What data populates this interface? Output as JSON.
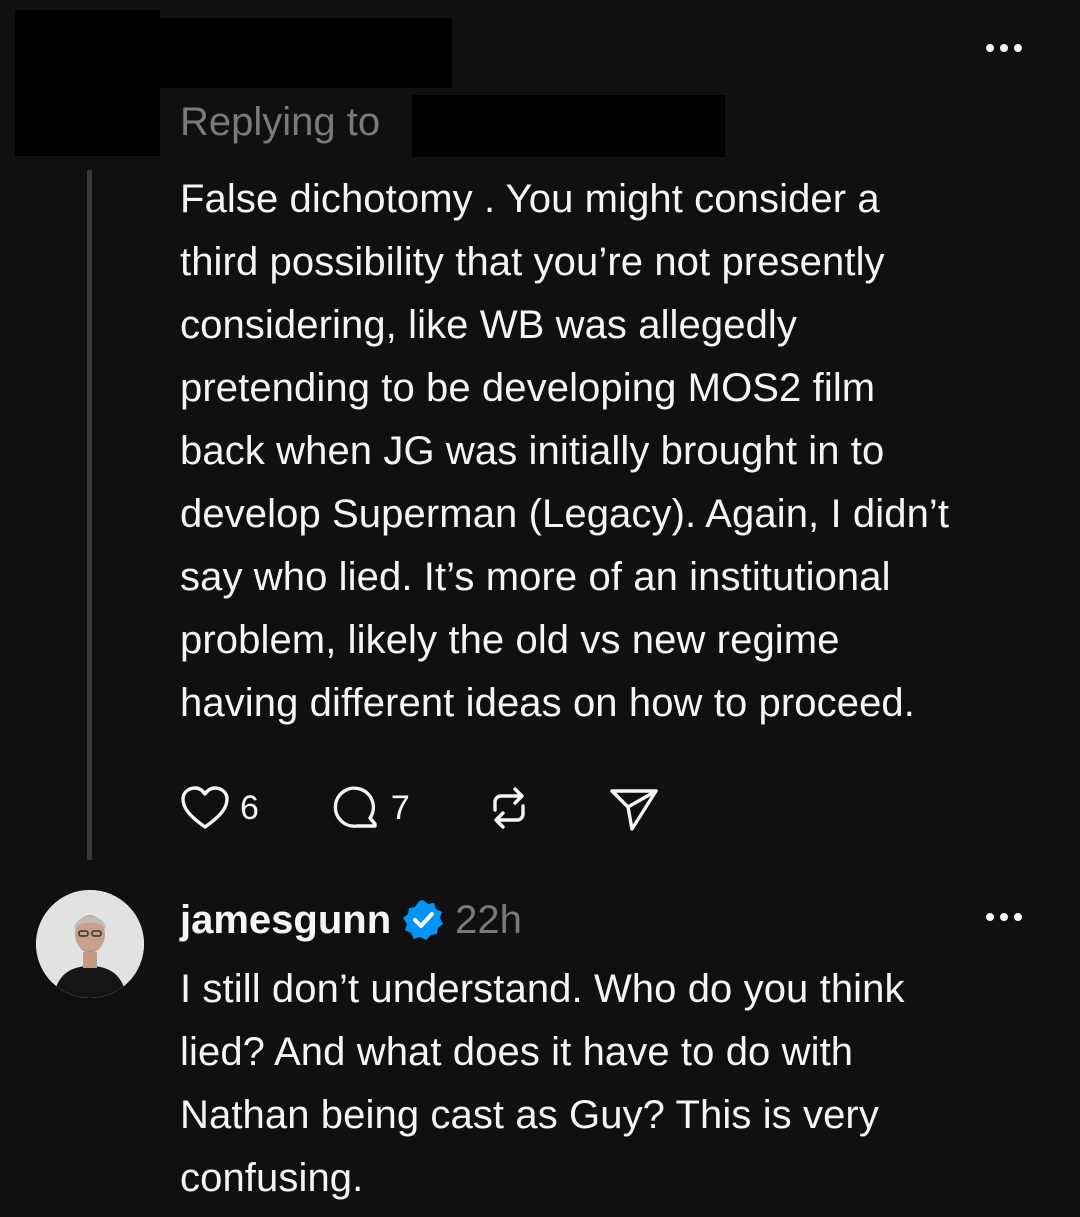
{
  "reply_header": {
    "prefix": "Replying to"
  },
  "parent_post": {
    "paragraph_lines": [
      "False dichotomy . You might consider a",
      "third possibility that you’re not presently",
      "considering, like WB was allegedly",
      "pretending to be developing MOS2 film",
      "back when JG was initially brought in to",
      "develop Superman (Legacy). Again, I didn’t",
      "say who lied. It’s more of an institutional",
      "problem, likely the old vs new regime",
      "having different ideas on how to proceed."
    ],
    "actions": {
      "like_icon": "heart-icon",
      "like_count": "6",
      "reply_icon": "comment-icon",
      "reply_count": "7",
      "repost_icon": "repost-icon",
      "share_icon": "send-icon"
    },
    "more_icon": "more-icon"
  },
  "reply_post": {
    "username": "jamesgunn",
    "verified_icon": "verified-badge-icon",
    "timestamp": "22h",
    "paragraph_lines": [
      "I still don’t understand. Who do you think",
      "lied? And what does it have to do with",
      "Nathan being cast as Guy? This is very",
      "confusing."
    ],
    "more_icon": "more-icon"
  },
  "colors": {
    "background": "#101010",
    "primary_text": "#f3f5f7",
    "secondary_text": "#7a7a7a",
    "verified_blue": "#0095f6",
    "thread_line": "#3a3a3a",
    "redaction": "#000000"
  }
}
